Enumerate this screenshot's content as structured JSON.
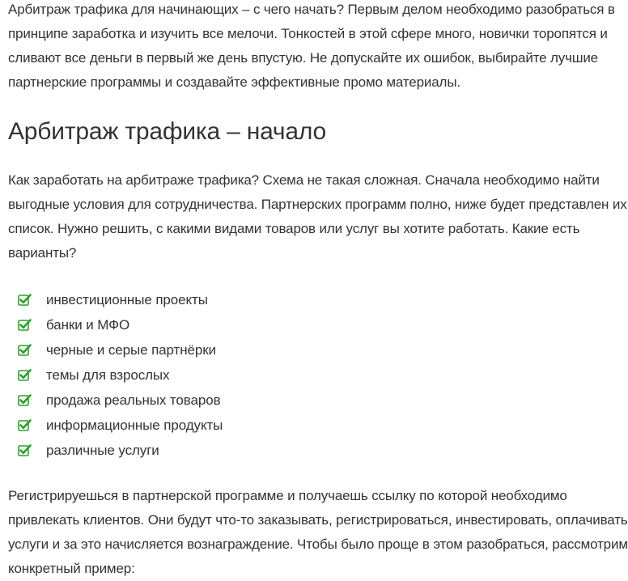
{
  "article": {
    "intro": "Арбитраж трафика для начинающих – с чего начать? Первым делом необходимо разобраться в принципе заработка и изучить все мелочи. Тонкостей в этой сфере много, новички торопятся и сливают все деньги в первый же день впустую. Не допускайте их ошибок, выбирайте лучшие партнерские программы и создавайте эффективные промо материалы.",
    "heading": "Арбитраж трафика – начало",
    "how_paragraph": "Как заработать на арбитраже трафика? Схема не такая сложная. Сначала необходимо найти выгодные условия для сотрудничества. Партнерских программ полно, ниже будет представлен их список. Нужно решить, с какими видами товаров или услуг вы хотите работать. Какие есть варианты?",
    "checklist": [
      "инвестиционные проекты",
      "банки и МФО",
      "черные и серые партнёрки",
      "темы для взрослых",
      "продажа реальных товаров",
      "информационные продукты",
      "различные услуги"
    ],
    "register_paragraph": "Регистрируешься в партнерской программе и получаешь ссылку по которой необходимо привлекать клиентов. Они будут что-то заказывать, регистрироваться, инвестировать, оплачивать услуги и за это начисляется вознаграждение. Чтобы было проще в этом разобраться, рассмотрим конкретный пример:"
  },
  "icons": {
    "check": "check-square-icon",
    "check_color": "#2e9e2e"
  }
}
